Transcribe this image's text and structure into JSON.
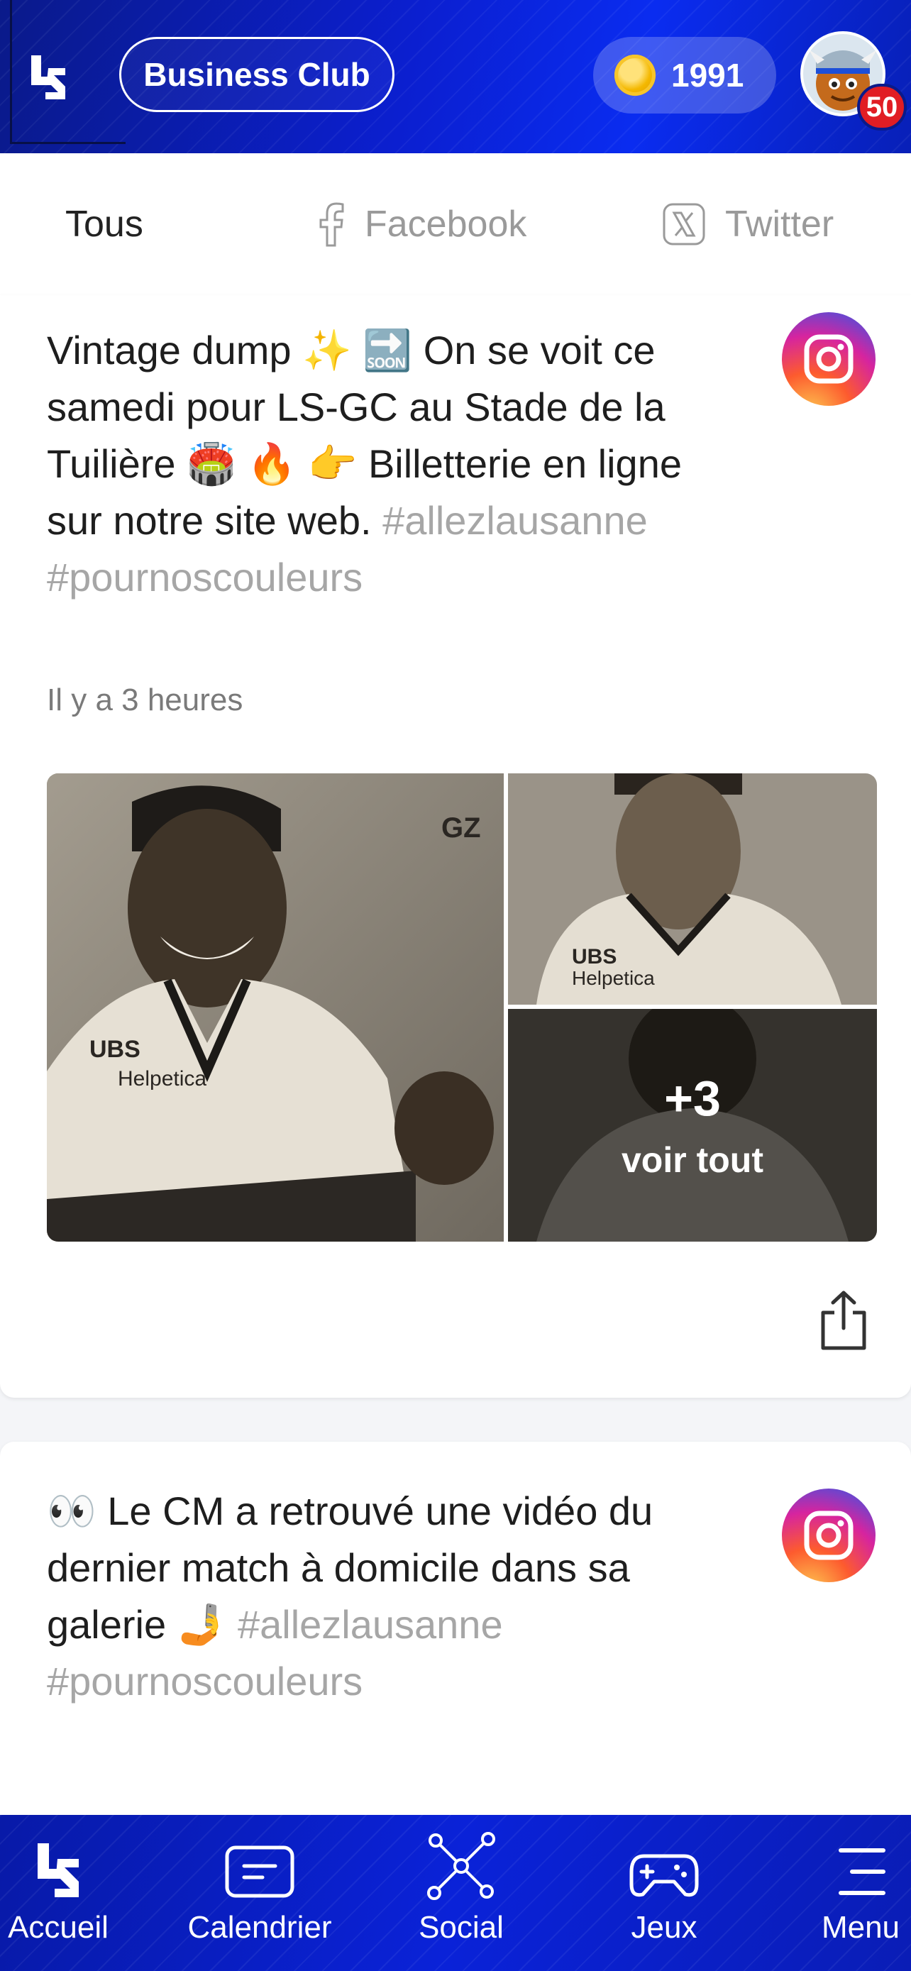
{
  "header": {
    "club_button": "Business Club",
    "coins": "1991",
    "notifications": "50"
  },
  "tabs": [
    {
      "label": "Tous"
    },
    {
      "label": "Facebook"
    },
    {
      "label": "Twitter"
    }
  ],
  "posts": [
    {
      "text": "Vintage dump ✨ 🔜 On se voit ce samedi pour LS-GC au Stade de la Tuilière 🏟️ 🔥 👉 Billetterie en ligne sur notre site web.",
      "hashtags": "#allezlausanne #pournoscouleurs",
      "time": "Il y a 3 heures",
      "network_icon": "instagram-icon",
      "more_count": "+3",
      "see_all": "voir tout"
    },
    {
      "text": "👀 Le CM a retrouvé une vidéo du dernier match à domicile dans sa galerie 🤳",
      "hashtags": "#allezlausanne #pournoscouleurs",
      "network_icon": "instagram-icon"
    }
  ],
  "bottom_nav": [
    {
      "label": "Accueil",
      "icon": "ls-logo-icon"
    },
    {
      "label": "Calendrier",
      "icon": "calendar-icon"
    },
    {
      "label": "Social",
      "icon": "network-icon"
    },
    {
      "label": "Jeux",
      "icon": "gamepad-icon"
    },
    {
      "label": "Menu",
      "icon": "menu-icon"
    }
  ],
  "colors": {
    "header_blue": "#0b1fd0",
    "hashtag_gray": "#a6a6a6",
    "badge_red": "#e11d24",
    "coin_gold": "#f4b800"
  }
}
